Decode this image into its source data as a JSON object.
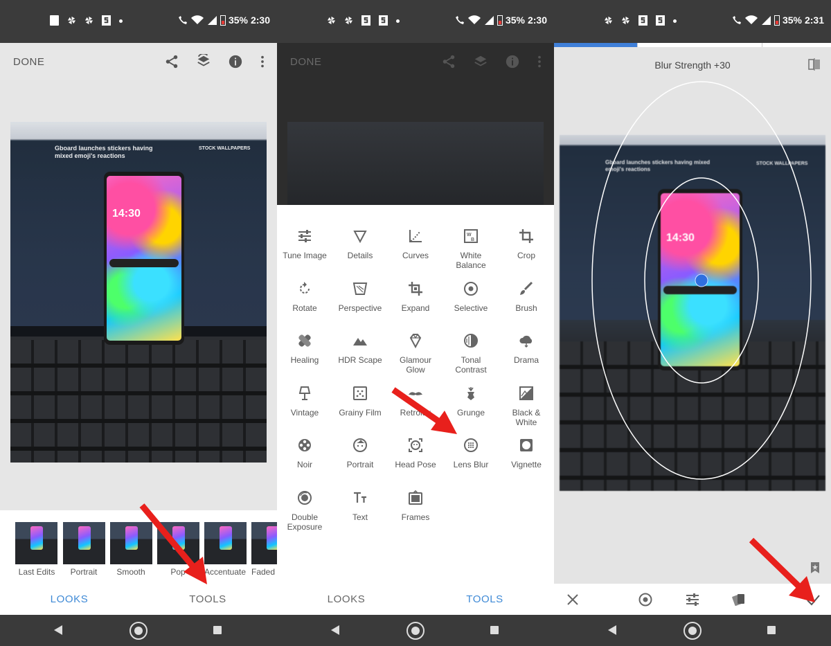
{
  "panels": [
    {
      "status": {
        "battery": "35%",
        "time": "2:30"
      },
      "done_label": "DONE",
      "looks": [
        {
          "label": "Last Edits"
        },
        {
          "label": "Portrait"
        },
        {
          "label": "Smooth"
        },
        {
          "label": "Pop"
        },
        {
          "label": "Accentuate"
        },
        {
          "label": "Faded G"
        }
      ],
      "tabs": {
        "looks": "LOOKS",
        "tools": "TOOLS",
        "active": "looks"
      }
    },
    {
      "status": {
        "battery": "35%",
        "time": "2:30"
      },
      "done_label": "DONE",
      "tools": [
        {
          "label": "Tune Image",
          "icon": "tune-icon"
        },
        {
          "label": "Details",
          "icon": "details-triangle-icon"
        },
        {
          "label": "Curves",
          "icon": "curves-icon"
        },
        {
          "label": "White\nBalance",
          "icon": "white-balance-icon"
        },
        {
          "label": "Crop",
          "icon": "crop-icon"
        },
        {
          "label": "Rotate",
          "icon": "rotate-icon"
        },
        {
          "label": "Perspective",
          "icon": "perspective-icon"
        },
        {
          "label": "Expand",
          "icon": "expand-icon"
        },
        {
          "label": "Selective",
          "icon": "selective-icon"
        },
        {
          "label": "Brush",
          "icon": "brush-icon"
        },
        {
          "label": "Healing",
          "icon": "healing-bandage-icon"
        },
        {
          "label": "HDR Scape",
          "icon": "mountains-icon"
        },
        {
          "label": "Glamour\nGlow",
          "icon": "diamond-icon"
        },
        {
          "label": "Tonal\nContrast",
          "icon": "tonal-contrast-icon"
        },
        {
          "label": "Drama",
          "icon": "cloud-icon"
        },
        {
          "label": "Vintage",
          "icon": "lamp-icon"
        },
        {
          "label": "Grainy Film",
          "icon": "grain-icon"
        },
        {
          "label": "Retrolux",
          "icon": "mustache-icon"
        },
        {
          "label": "Grunge",
          "icon": "guitar-icon"
        },
        {
          "label": "Black &\nWhite",
          "icon": "black-white-icon"
        },
        {
          "label": "Noir",
          "icon": "film-reel-icon"
        },
        {
          "label": "Portrait",
          "icon": "face-icon"
        },
        {
          "label": "Head Pose",
          "icon": "head-pose-icon"
        },
        {
          "label": "Lens Blur",
          "icon": "lens-blur-icon"
        },
        {
          "label": "Vignette",
          "icon": "vignette-icon"
        },
        {
          "label": "Double\nExposure",
          "icon": "double-exposure-icon"
        },
        {
          "label": "Text",
          "icon": "text-icon"
        },
        {
          "label": "Frames",
          "icon": "frames-icon"
        }
      ],
      "tabs": {
        "looks": "LOOKS",
        "tools": "TOOLS",
        "active": "tools"
      }
    },
    {
      "status": {
        "battery": "35%",
        "time": "2:31"
      },
      "blur_label": "Blur Strength +30"
    }
  ],
  "photo_texts": {
    "article_title": "Gboard launches stickers having mixed emoji's reactions",
    "sidebar_heading": "STOCK WALLPAPERS",
    "phone_time": "14:30"
  },
  "colors": {
    "accent": "#3f8ad6",
    "arrow": "#e8201c",
    "focus_dot": "#2f6fe0"
  }
}
